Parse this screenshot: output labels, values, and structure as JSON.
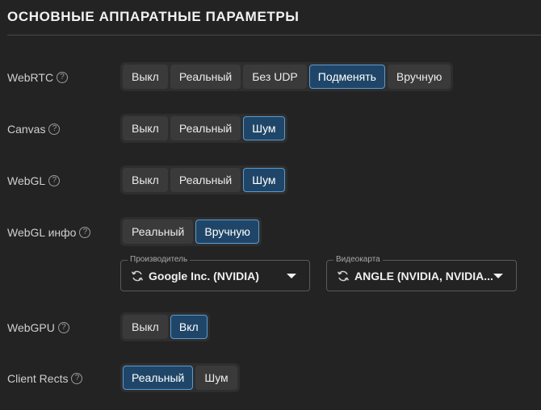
{
  "section": {
    "title": "ОСНОВНЫЕ АППАРАТНЫЕ ПАРАМЕТРЫ"
  },
  "help_glyph": "?",
  "rows": {
    "webrtc": {
      "label": "WebRTC",
      "options": [
        "Выкл",
        "Реальный",
        "Без UDP",
        "Подменять",
        "Вручную"
      ],
      "selected": "Подменять"
    },
    "canvas": {
      "label": "Canvas",
      "options": [
        "Выкл",
        "Реальный",
        "Шум"
      ],
      "selected": "Шум"
    },
    "webgl": {
      "label": "WebGL",
      "options": [
        "Выкл",
        "Реальный",
        "Шум"
      ],
      "selected": "Шум"
    },
    "webgl_info": {
      "label": "WebGL инфо",
      "options": [
        "Реальный",
        "Вручную"
      ],
      "selected": "Вручную",
      "vendor": {
        "label": "Производитель",
        "value": "Google Inc. (NVIDIA)"
      },
      "renderer": {
        "label": "Видеокарта",
        "value": "ANGLE (NVIDIA, NVIDIA..."
      }
    },
    "webgpu": {
      "label": "WebGPU",
      "options": [
        "Выкл",
        "Вкл"
      ],
      "selected": "Вкл"
    },
    "client_rects": {
      "label": "Client Rects",
      "options": [
        "Реальный",
        "Шум"
      ],
      "selected": "Реальный"
    }
  },
  "colors": {
    "background": "#232323",
    "active_fill": "#1f4668",
    "active_border": "#5d9bd0"
  }
}
